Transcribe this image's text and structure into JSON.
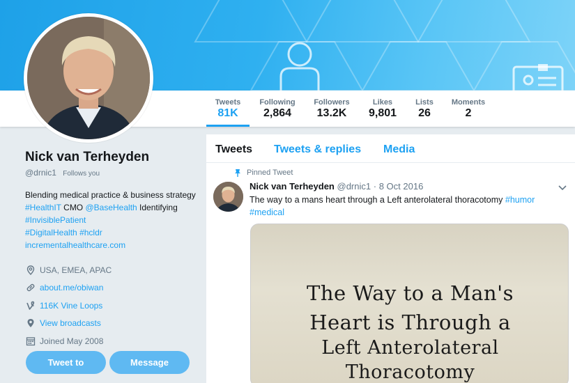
{
  "stats": [
    {
      "label": "Tweets",
      "value": "81K",
      "active": true
    },
    {
      "label": "Following",
      "value": "2,864"
    },
    {
      "label": "Followers",
      "value": "13.2K"
    },
    {
      "label": "Likes",
      "value": "9,801"
    },
    {
      "label": "Lists",
      "value": "26"
    },
    {
      "label": "Moments",
      "value": "2"
    }
  ],
  "profile": {
    "name": "Nick van Terheyden",
    "handle": "@drnic1",
    "follows_you": "Follows you",
    "bio": {
      "t1": "Blending medical practice & business strategy ",
      "l1": "#HealthIT",
      "t2": " CMO ",
      "l2": "@BaseHealth",
      "t3": " Identifying ",
      "l3": "#InvisiblePatient",
      "l4": "#DigitalHealth",
      "l5": "#hcldr",
      "l6": "incrementalhealthcare.com"
    },
    "meta": [
      {
        "icon": "location-icon",
        "text": "USA, EMEA, APAC",
        "link": false
      },
      {
        "icon": "link-icon",
        "text": "about.me/obiwan",
        "link": true
      },
      {
        "icon": "vine-icon",
        "text": "116K Vine Loops",
        "link": true
      },
      {
        "icon": "pin-icon",
        "text": "View broadcasts",
        "link": true
      },
      {
        "icon": "calendar-icon",
        "text": "Joined May 2008",
        "link": false
      }
    ],
    "buttons": {
      "tweet_to": "Tweet to",
      "message": "Message"
    }
  },
  "timeline": {
    "tabs": [
      "Tweets",
      "Tweets & replies",
      "Media"
    ],
    "pinned_label": "Pinned Tweet",
    "tweet": {
      "name": "Nick van Terheyden",
      "handle": "@drnic1",
      "date": "8 Oct 2016",
      "text": "The way to a mans heart through a Left anterolateral thoracotomy ",
      "tag1": "#humor",
      "tag2": "#medical",
      "image_text": [
        "The Way to a Man's",
        "Heart is Through a",
        "Left Anterolateral",
        "Thoracotomy"
      ]
    }
  },
  "colors": {
    "accent": "#1da1f2",
    "button": "#5fb9f2",
    "background": "#e6ecf0"
  }
}
